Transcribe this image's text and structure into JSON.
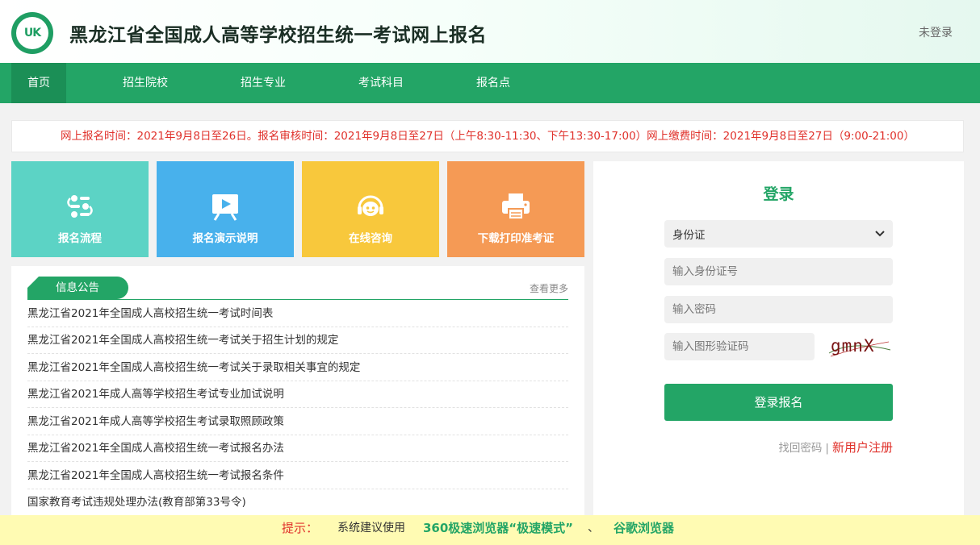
{
  "header": {
    "logo_text": "UK",
    "title": "黑龙江省全国成人高等学校招生统一考试网上报名",
    "login_status": "未登录"
  },
  "nav": {
    "items": [
      {
        "label": "首页",
        "active": true
      },
      {
        "label": "招生院校"
      },
      {
        "label": "招生专业"
      },
      {
        "label": "考试科目"
      },
      {
        "label": "报名点"
      }
    ]
  },
  "notice": {
    "text": "网上报名时间：2021年9月8日至26日。报名审核时间：2021年9月8日至27日（上午8:30-11:30、下午13:30-17:00）网上缴费时间：2021年9月8日至27日（9:00-21:00）"
  },
  "tiles": [
    {
      "label": "报名流程",
      "icon": "flow-icon",
      "color": "#5cd3c5"
    },
    {
      "label": "报名演示说明",
      "icon": "presentation-icon",
      "color": "#48b1ec"
    },
    {
      "label": "在线咨询",
      "icon": "headset-icon",
      "color": "#f8c83c"
    },
    {
      "label": "下载打印准考证",
      "icon": "printer-icon",
      "color": "#f59a55"
    }
  ],
  "info": {
    "tab_label": "信息公告",
    "more_label": "查看更多",
    "items": [
      "黑龙江省2021年全国成人高校招生统一考试时间表",
      "黑龙江省2021年全国成人高校招生统一考试关于招生计划的规定",
      "黑龙江省2021年全国成人高校招生统一考试关于录取相关事宜的规定",
      "黑龙江省2021年成人高等学校招生考试专业加试说明",
      "黑龙江省2021年成人高等学校招生考试录取照顾政策",
      "黑龙江省2021年全国成人高校招生统一考试报名办法",
      "黑龙江省2021年全国成人高校招生统一考试报名条件",
      "国家教育考试违规处理办法(教育部第33号令)"
    ]
  },
  "login": {
    "title": "登录",
    "id_type": "身份证",
    "id_placeholder": "输入身份证号",
    "password_placeholder": "输入密码",
    "captcha_placeholder": "输入图形验证码",
    "captcha_text": "gmnX",
    "submit_label": "登录报名",
    "forgot_label": "找回密码",
    "separator": "|",
    "register_label": "新用户注册"
  },
  "tipbar": {
    "label": "提示：",
    "text": "系统建议使用",
    "browser1": "360极速浏览器“极速模式”",
    "sep": "、",
    "browser2": "谷歌浏览器"
  }
}
